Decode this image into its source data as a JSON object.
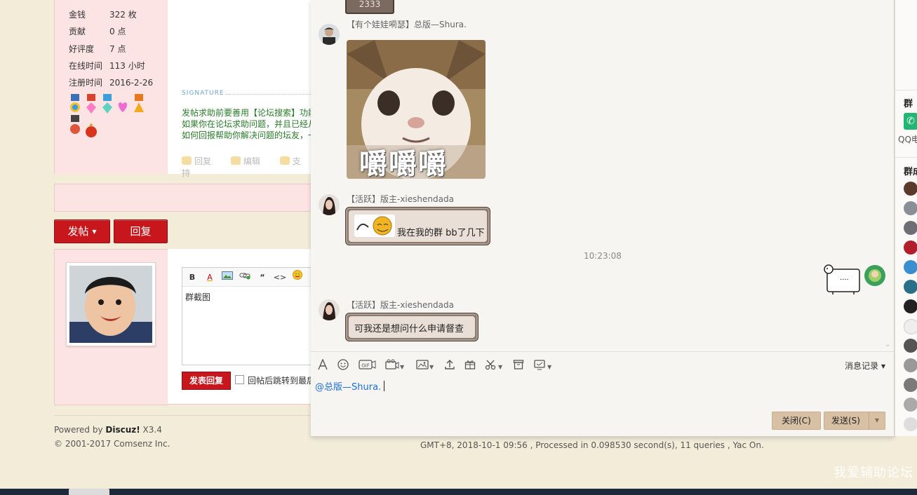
{
  "forum": {
    "profile_stats": [
      {
        "label": "金钱",
        "value": "322 枚"
      },
      {
        "label": "贡献",
        "value": "0 点"
      },
      {
        "label": "好评度",
        "value": "7 点"
      },
      {
        "label": "在线时间",
        "value": "113 小时"
      },
      {
        "label": "注册时间",
        "value": "2016-2-26"
      }
    ],
    "signature_label": "SIGNATURE",
    "signature_lines": [
      "发帖求助前要善用【论坛搜索】功能",
      "如果你在论坛求助问题，并且已经从",
      "如何回报帮助你解决问题的坛友，一"
    ],
    "post_actions": {
      "reply": "回复",
      "edit": "编辑",
      "support": "支持"
    },
    "new_post_button": "发帖",
    "reply_button": "回复",
    "editor_toolbar": [
      "B",
      "A",
      "img",
      "link",
      "“",
      "<>",
      "smile"
    ],
    "editor_content": "群截图",
    "submit_reply": "发表回复",
    "jump_checkbox_label": "回帖后跳转到最后",
    "powered_by_prefix": "Powered by ",
    "powered_by_brand": "Discuz!",
    "powered_by_version": " X3.4",
    "copyright": "© 2001-2017 Comsenz Inc.",
    "footer_stats": "GMT+8, 2018-10-1 09:56 , Processed in 0.098530 second(s), 11 queries , Yac On.",
    "watermark": "我爱辅助论坛"
  },
  "chat": {
    "top_bubble_text": "2333",
    "messages": [
      {
        "sender": "【有个娃娃嗬瑟】总版—Shura.",
        "sticker_caption": "嚼嚼嚼"
      },
      {
        "sender": "【活跃】版主-xieshendada",
        "text": "我在我的群 bb了几下"
      },
      {
        "sender": "【活跃】版主-xieshendada",
        "text": "可我还是想问什么申请督查"
      }
    ],
    "timestamp": "10:23:08",
    "own_message_text": "....",
    "toolbar_icons": [
      "font-icon",
      "emoji-icon",
      "gif-icon",
      "video-icon",
      "image-icon",
      "upload-icon",
      "gift-icon",
      "scissors-icon",
      "archive-icon",
      "screen-icon"
    ],
    "message_record": "消息记录",
    "input_text": "@总版—Shura.",
    "close_button": "关闭(C)",
    "send_button": "发送(S)"
  },
  "group_sidebar": {
    "section1": "群",
    "phone_label": "QQ电",
    "section2": "群成"
  },
  "colors": {
    "accent_red": "#c8161d",
    "bubble_brown": "#8b7b70",
    "link_blue": "#1a6ed8",
    "send_button": "#d7c0a4"
  }
}
